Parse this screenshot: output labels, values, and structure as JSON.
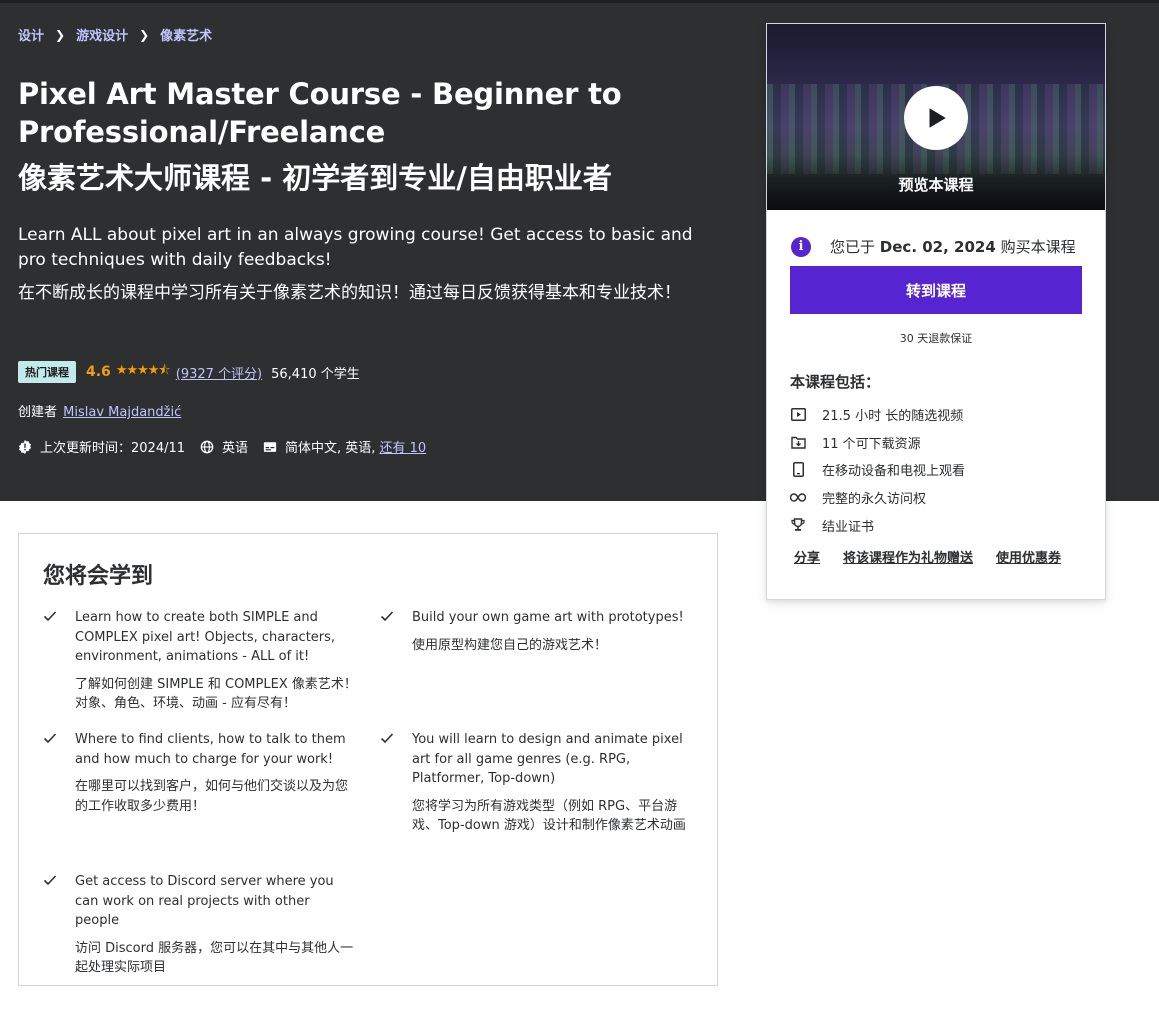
{
  "breadcrumb": [
    "设计",
    "游戏设计",
    "像素艺术"
  ],
  "title_en": "Pixel Art Master Course - Beginner to Professional/Freelance",
  "title_zh": "像素艺术大师课程 - 初学者到专业/自由职业者",
  "subtitle_en": "Learn ALL about pixel art in an always growing course! Get access to basic and pro techniques with daily feedbacks!",
  "subtitle_zh": "在不断成长的课程中学习所有关于像素艺术的知识！通过每日反馈获得基本和专业技术！",
  "badge": "热门课程",
  "rating": "4.6",
  "rating_link": "(9327 个评分)",
  "students": "56,410 个学生",
  "creator_label": "创建者",
  "creator_name": "Mislav Majdandžić",
  "updated": "上次更新时间：2024/11",
  "language": "英语",
  "captions": "简体中文, 英语,",
  "captions_more": "还有 10",
  "preview_label": "预览本课程",
  "purchase": {
    "prefix": "您已于",
    "date": "Dec. 02, 2024",
    "suffix": "购买本课程"
  },
  "go_button": "转到课程",
  "guarantee": "30 天退款保证",
  "includes_title": "本课程包括：",
  "includes": [
    {
      "icon": "video-icon",
      "label": "21.5 小时 长的随选视频"
    },
    {
      "icon": "download-icon",
      "label": "11 个可下载资源"
    },
    {
      "icon": "mobile-icon",
      "label": "在移动设备和电视上观看"
    },
    {
      "icon": "infinity-icon",
      "label": "完整的永久访问权"
    },
    {
      "icon": "trophy-icon",
      "label": "结业证书"
    }
  ],
  "actions": [
    "分享",
    "将该课程作为礼物赠送",
    "使用优惠券"
  ],
  "learn_title": "您将会学到",
  "learn_items": [
    {
      "en": "Learn how to create both SIMPLE and COMPLEX pixel art! Objects, characters, environment, animations - ALL of it!",
      "zh": "了解如何创建 SIMPLE 和 COMPLEX 像素艺术！对象、角色、环境、动画 - 应有尽有！"
    },
    {
      "en": "Build your own game art with prototypes!",
      "zh": "使用原型构建您自己的游戏艺术！"
    },
    {
      "en": "Where to find clients, how to talk to them and how much to charge for your work!",
      "zh": "在哪里可以找到客户，如何与他们交谈以及为您的工作收取多少费用！"
    },
    {
      "en": "You will learn to design and animate pixel art for all game genres (e.g. RPG, Platformer, Top-down)",
      "zh": "您将学习为所有游戏类型（例如 RPG、平台游戏、Top-down 游戏）设计和制作像素艺术动画"
    },
    {
      "en": "Get access to Discord server where you can work on real projects with other people",
      "zh": "访问 Discord 服务器，您可以在其中与其他人一起处理实际项目"
    }
  ],
  "colors": {
    "hero_bg": "#2d2f31",
    "accent": "#5624d0",
    "link": "#c0c4fc",
    "star": "#f69c08",
    "badge_bg": "#c2e9eb"
  }
}
